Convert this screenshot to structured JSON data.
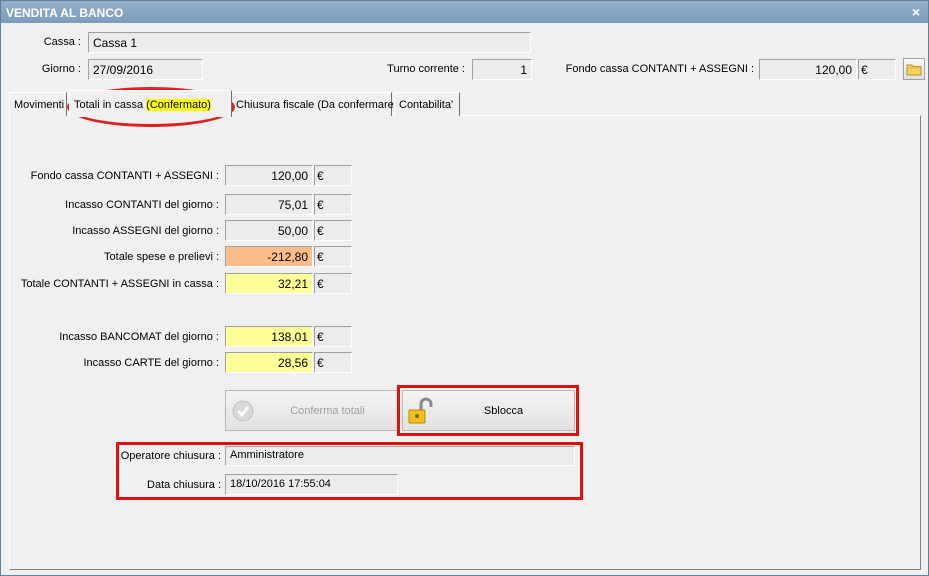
{
  "window": {
    "title": "VENDITA AL BANCO",
    "close_label": "×"
  },
  "header": {
    "cassa_label": "Cassa :",
    "cassa_value": "Cassa 1",
    "giorno_label": "Giorno :",
    "giorno_value": "27/09/2016",
    "turno_label": "Turno corrente :",
    "turno_value": "1",
    "fondo_label": "Fondo cassa CONTANTI + ASSEGNI :",
    "fondo_value": "120,00",
    "fondo_currency": "€",
    "folder_icon": "folder-icon"
  },
  "tabs": [
    {
      "label": "Movimenti"
    },
    {
      "label_prefix": "Totali in cassa ",
      "label_highlight": "(Confermato)",
      "active": true
    },
    {
      "label": "Chiusura fiscale (Da confermare)"
    },
    {
      "label": "Contabilita'"
    }
  ],
  "totals": {
    "currency": "€",
    "rows": [
      {
        "label": "Fondo cassa CONTANTI + ASSEGNI :",
        "value": "120,00"
      },
      {
        "label": "Incasso CONTANTI del giorno :",
        "value": "75,01"
      },
      {
        "label": "Incasso ASSEGNI del giorno :",
        "value": "50,00"
      },
      {
        "label": "Totale spese e prelievi :",
        "value": "-212,80"
      },
      {
        "label": "Totale CONTANTI + ASSEGNI in cassa :",
        "value": "32,21"
      },
      {
        "label": "Incasso BANCOMAT del giorno :",
        "value": "138,01"
      },
      {
        "label": "Incasso CARTE del giorno :",
        "value": "28,56"
      }
    ]
  },
  "buttons": {
    "conferma_label": "Conferma totali",
    "sblocca_label": "Sblocca"
  },
  "closure": {
    "operatore_label": "Operatore chiusura :",
    "operatore_value": "Amministratore",
    "data_label": "Data chiusura :",
    "data_value": "18/10/2016 17:55:04"
  },
  "colors": {
    "highlight_yellow": "#ffff99",
    "highlight_orange": "#fdbd8a",
    "annotation_red": "#e01010",
    "title_bar": "#7d9cbc"
  }
}
